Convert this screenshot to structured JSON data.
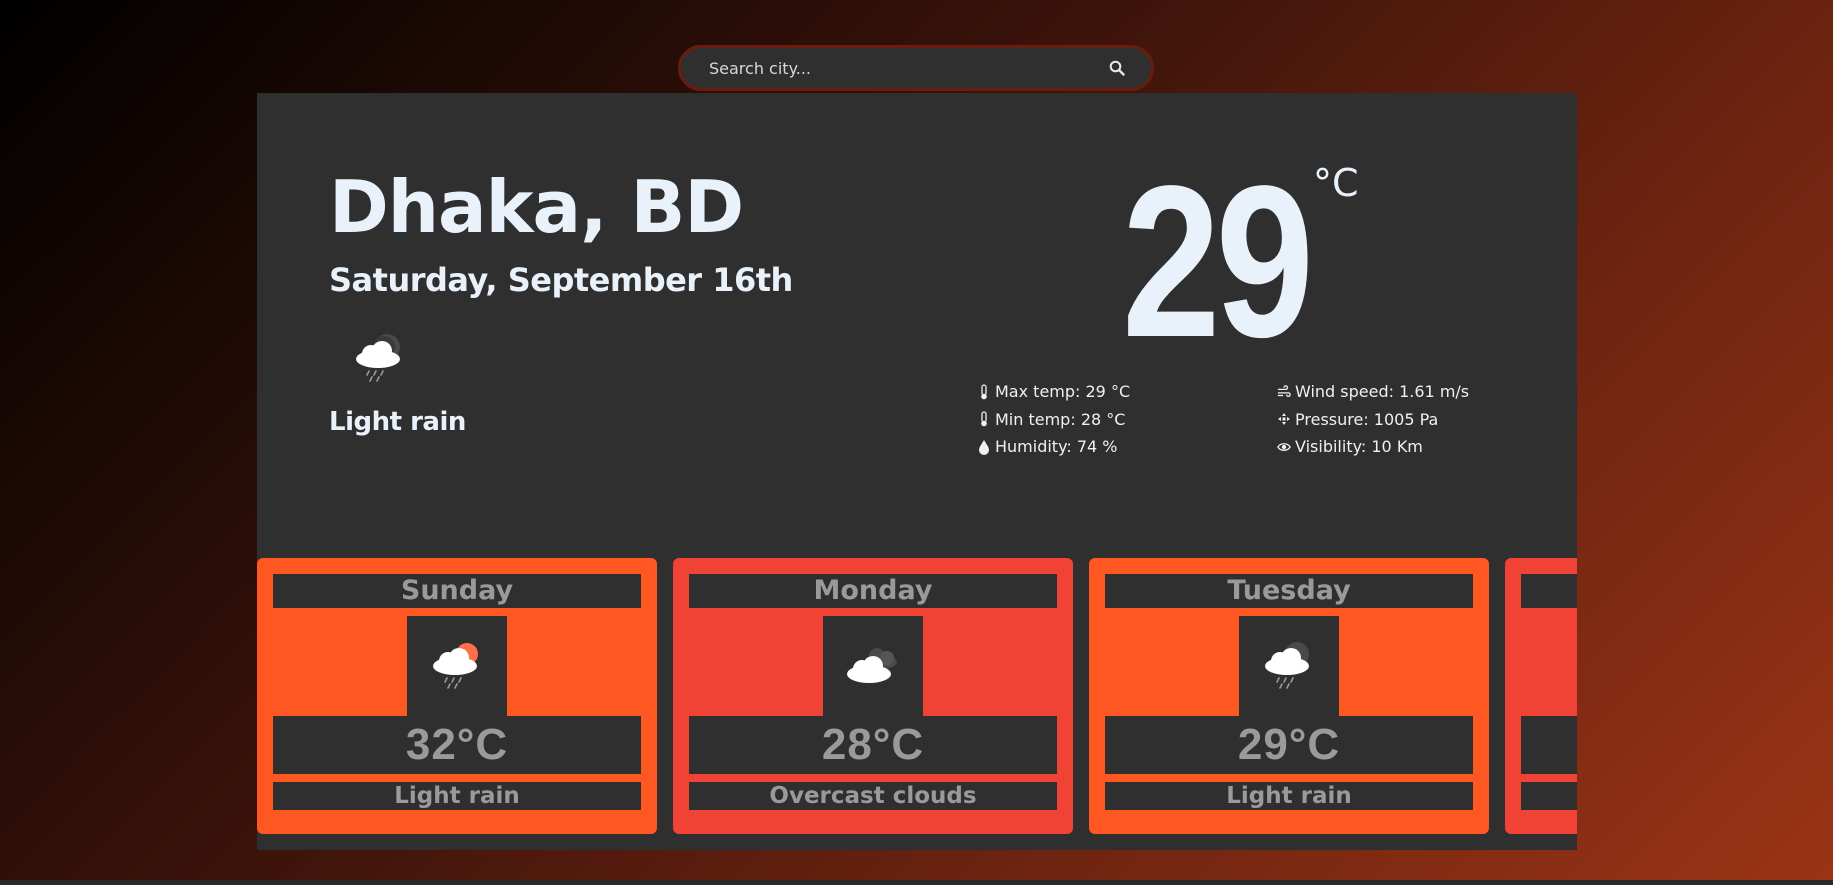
{
  "search": {
    "placeholder": "Search city..."
  },
  "current": {
    "city": "Dhaka, BD",
    "date": "Saturday, September 16th",
    "condition": "Light rain",
    "temperature": "29",
    "unit": "°C",
    "stats_left": [
      {
        "icon": "thermometer-icon",
        "text": "Max temp: 29 °C"
      },
      {
        "icon": "thermometer-icon",
        "text": "Min temp: 28 °C"
      },
      {
        "icon": "droplet-icon",
        "text": "Humidity: 74 %"
      }
    ],
    "stats_right": [
      {
        "icon": "wind-icon",
        "text": "Wind speed: 1.61 m/s"
      },
      {
        "icon": "pressure-icon",
        "text": "Pressure: 1005 Pa"
      },
      {
        "icon": "eye-icon",
        "text": "Visibility: 10 Km"
      }
    ]
  },
  "forecast": [
    {
      "day": "Sunday",
      "temp": "32°C",
      "desc": "Light rain",
      "icon": "cloud-rain-sun-icon",
      "color": "#ff5722"
    },
    {
      "day": "Monday",
      "temp": "28°C",
      "desc": "Overcast clouds",
      "icon": "overcast-clouds-icon",
      "color": "#f04336"
    },
    {
      "day": "Tuesday",
      "temp": "29°C",
      "desc": "Light rain",
      "icon": "cloud-rain-moon-icon",
      "color": "#ff5722"
    },
    {
      "day": "",
      "temp": "",
      "desc": "",
      "icon": "",
      "color": "#f04336"
    }
  ],
  "colors": {
    "card_bg": "#2f2f2f",
    "orange": "#ff5722",
    "red": "#f04336",
    "text_light": "#e9f2fb"
  }
}
